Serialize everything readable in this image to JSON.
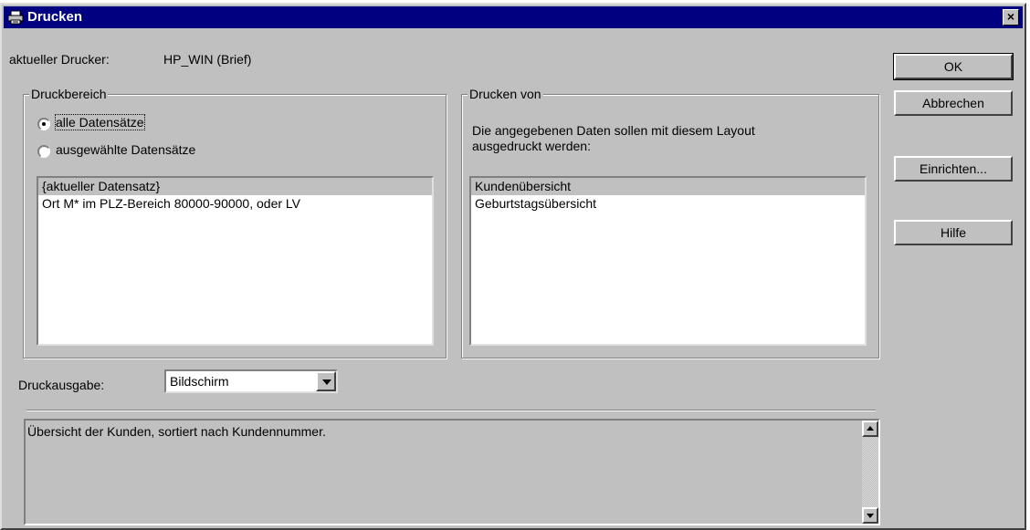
{
  "window": {
    "title": "Drucken",
    "close_label": "×"
  },
  "printer": {
    "label": "aktueller Drucker:",
    "value": "HP_WIN (Brief)"
  },
  "print_range": {
    "legend": "Druckbereich",
    "radio_all": "alle Datensätze",
    "radio_selected": "ausgewählte Datensätze",
    "selected_option": "alle Datensätze",
    "items": [
      "{aktueller Datensatz}",
      "Ort M* im PLZ-Bereich 80000-90000, oder LV"
    ]
  },
  "print_from": {
    "legend": "Drucken von",
    "description": "Die angegebenen Daten sollen mit diesem Layout",
    "description_line2": "ausgedruckt werden:",
    "items": [
      "Kundenübersicht",
      "Geburtstagsübersicht"
    ]
  },
  "output": {
    "label": "Druckausgabe:",
    "value": "Bildschirm"
  },
  "description_text": "Übersicht der Kunden, sortiert nach Kundennummer.",
  "buttons": {
    "ok": "OK",
    "cancel": "Abbrechen",
    "setup": "Einrichten...",
    "help": "Hilfe"
  },
  "icons": {
    "title": "printer-icon"
  },
  "colors": {
    "titlebar": "#000080",
    "face": "#c0c0c0"
  }
}
